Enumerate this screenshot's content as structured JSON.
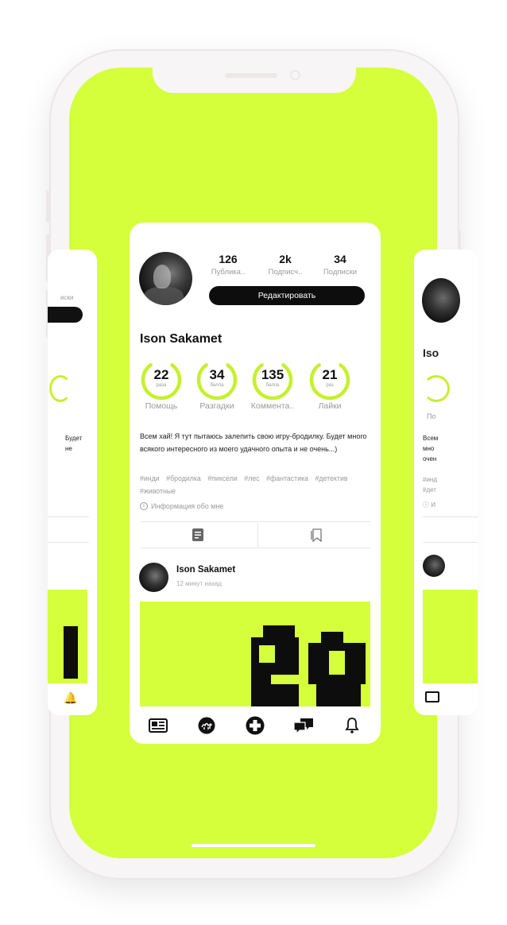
{
  "profile": {
    "name": "Ison Sakamet",
    "stats": [
      {
        "value": "126",
        "label": "Публика.."
      },
      {
        "value": "2k",
        "label": "Подписч.."
      },
      {
        "value": "34",
        "label": "Подписки"
      }
    ],
    "edit_label": "Редактировать",
    "achievements": [
      {
        "value": "22",
        "unit": "раза",
        "label": "Помощь",
        "fraction": 0.8
      },
      {
        "value": "34",
        "unit": "балла",
        "label": "Разгадки",
        "fraction": 0.8
      },
      {
        "value": "135",
        "unit": "балла",
        "label": "Коммента..",
        "fraction": 0.8
      },
      {
        "value": "21",
        "unit": "раз",
        "label": "Лайки",
        "fraction": 0.8
      }
    ],
    "bio": "Всем хай! Я тут пытаюсь залепить свою игру-бродилку. Будет много всякого интересного из моего удачного опыта и не очень...)",
    "tags": [
      "#инди",
      "#бродилка",
      "#пиксели",
      "#лес",
      "#фантастика",
      "#детектив",
      "#животные"
    ],
    "info_label": "Информация обо мне"
  },
  "post": {
    "author": "Ison Sakamet",
    "time": "12 минут назад"
  },
  "side_left": {
    "stat_label": "иски",
    "bio_line1": "Будет",
    "bio_line2": "не"
  },
  "side_right": {
    "name_fragment": "Iso",
    "ring_label": "По",
    "bio_line1": "Всем",
    "bio_line2": "мно",
    "bio_line3": "очен",
    "tag_line1": "#инд",
    "tag_line2": "#дет",
    "info_fragment": "И"
  },
  "nav": [
    "news-icon",
    "camel-icon",
    "plus-icon",
    "chat-icon",
    "bell-icon"
  ],
  "colors": {
    "accent": "#d4ff3a",
    "ring": "#c6f02e",
    "dark": "#0d0d0d"
  }
}
